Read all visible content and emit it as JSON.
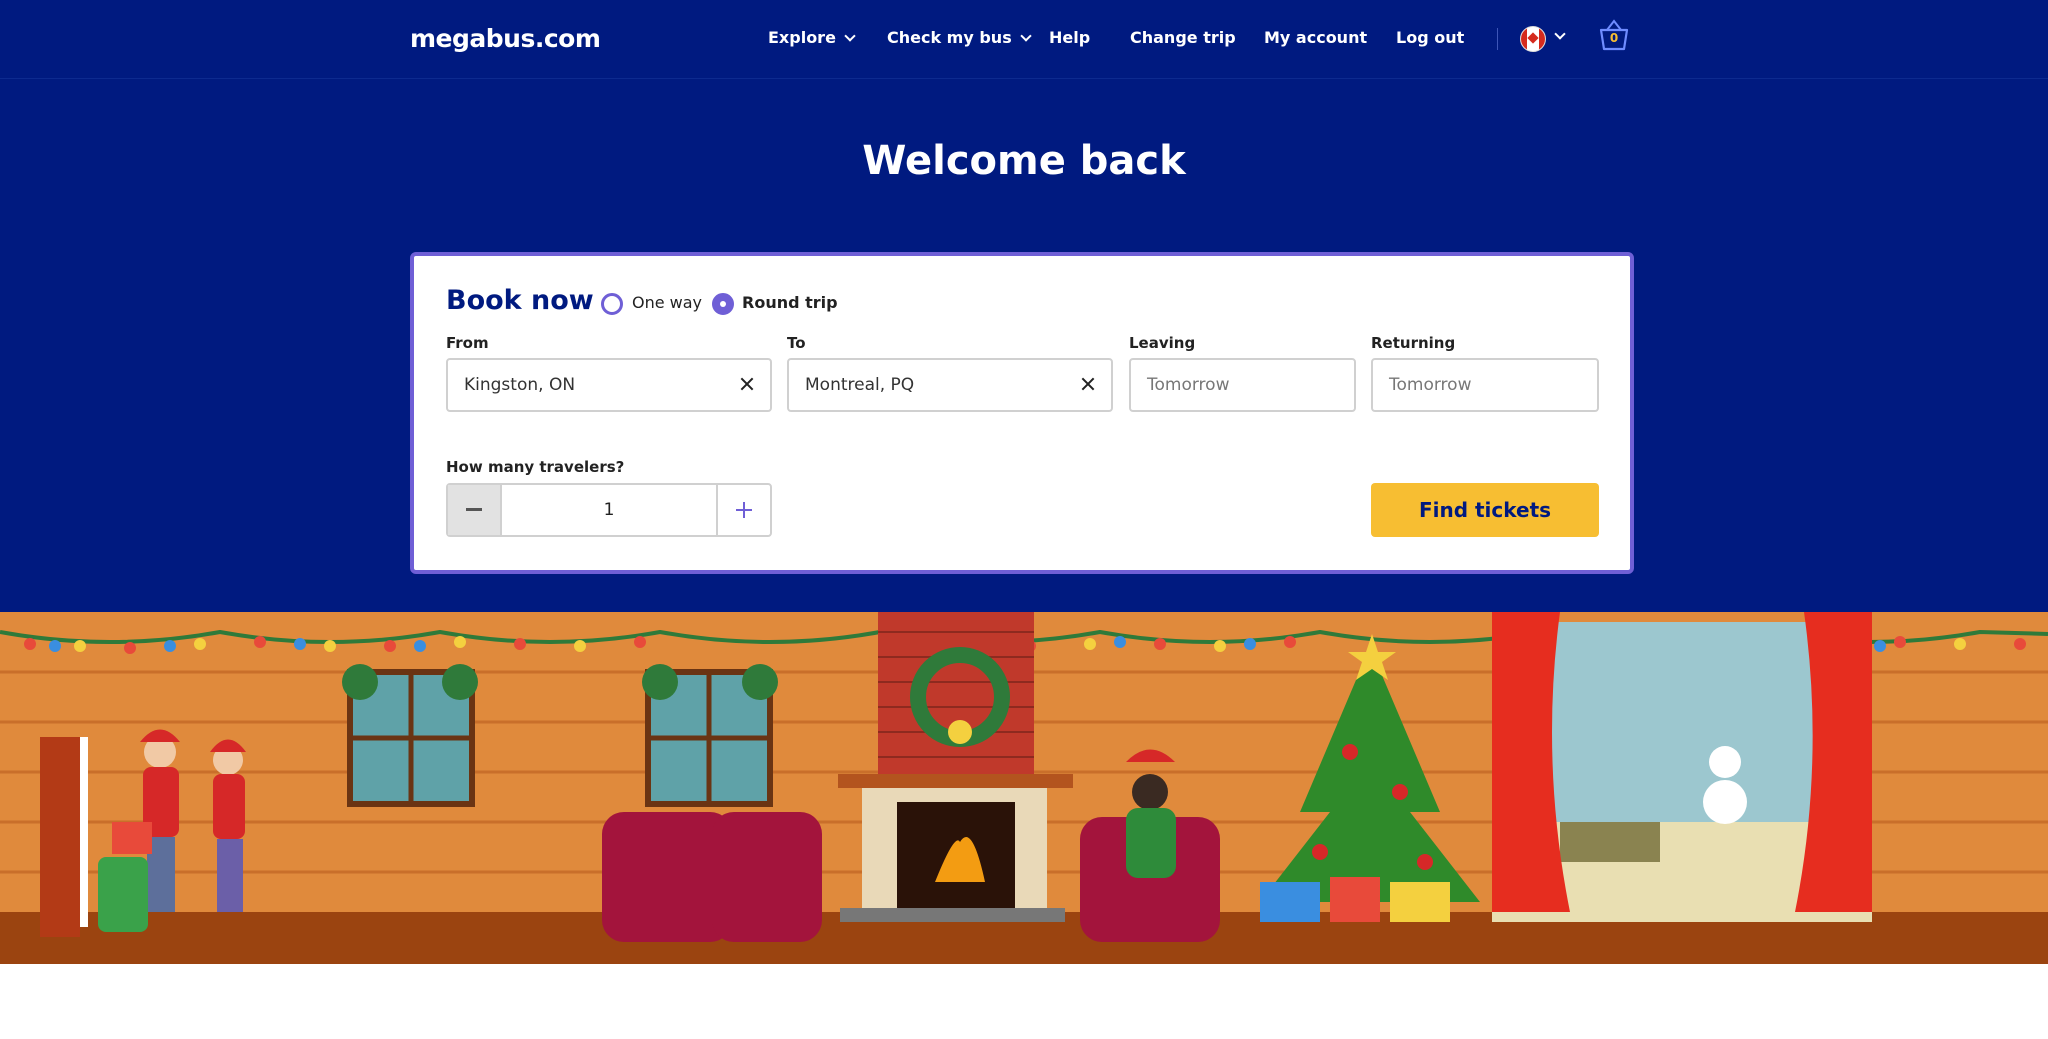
{
  "header": {
    "logo": "megabus.com",
    "nav": [
      {
        "label": "Explore",
        "dropdown": true
      },
      {
        "label": "Check my bus",
        "dropdown": true
      },
      {
        "label": "Help",
        "dropdown": false
      },
      {
        "label": "Change trip",
        "dropdown": false
      },
      {
        "label": "My account",
        "dropdown": false
      },
      {
        "label": "Log out",
        "dropdown": false
      }
    ],
    "country_icon": "canada-flag-icon",
    "basket_count": "0"
  },
  "hero": {
    "title": "Welcome back"
  },
  "booking": {
    "title": "Book now",
    "trip_types": [
      {
        "label": "One way",
        "selected": false
      },
      {
        "label": "Round trip",
        "selected": true
      }
    ],
    "from": {
      "label": "From",
      "value": "Kingston, ON"
    },
    "to": {
      "label": "To",
      "value": "Montreal, PQ"
    },
    "leaving": {
      "label": "Leaving",
      "placeholder": "Tomorrow"
    },
    "returning": {
      "label": "Returning",
      "placeholder": "Tomorrow"
    },
    "travelers": {
      "label": "How many travelers?",
      "value": "1"
    },
    "submit_label": "Find tickets"
  },
  "colors": {
    "navy": "#001a80",
    "accent_purple": "#6f5fd6",
    "button_yellow": "#f7be32"
  }
}
